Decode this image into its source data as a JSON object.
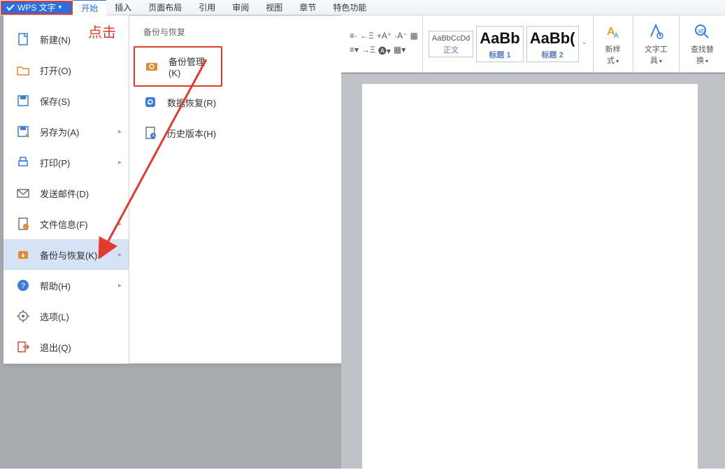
{
  "app": {
    "name": "WPS 文字"
  },
  "annotation": "点击",
  "tabs": [
    "开始",
    "插入",
    "页面布局",
    "引用",
    "审阅",
    "视图",
    "章节",
    "特色功能"
  ],
  "active_tab_index": 0,
  "menu": {
    "items": [
      {
        "label": "新建(N)",
        "icon": "file-new",
        "chev": false
      },
      {
        "label": "打开(O)",
        "icon": "folder-open",
        "chev": false
      },
      {
        "label": "保存(S)",
        "icon": "save",
        "chev": false
      },
      {
        "label": "另存为(A)",
        "icon": "save-as",
        "chev": true
      },
      {
        "label": "打印(P)",
        "icon": "print",
        "chev": true
      },
      {
        "label": "发送邮件(D)",
        "icon": "mail",
        "chev": false
      },
      {
        "label": "文件信息(F)",
        "icon": "file-info",
        "chev": true
      },
      {
        "label": "备份与恢复(K)",
        "icon": "backup",
        "chev": true,
        "hover": true
      },
      {
        "label": "帮助(H)",
        "icon": "help",
        "chev": true
      },
      {
        "label": "选项(L)",
        "icon": "options",
        "chev": false
      },
      {
        "label": "退出(Q)",
        "icon": "exit",
        "chev": false
      }
    ]
  },
  "submenu": {
    "title": "备份与恢复",
    "items": [
      {
        "label": "备份管理(K)",
        "icon": "backup-mgr",
        "boxed": true
      },
      {
        "label": "数据恢复(R)",
        "icon": "data-recover",
        "boxed": false
      },
      {
        "label": "历史版本(H)",
        "icon": "history",
        "boxed": false
      }
    ]
  },
  "ribbon": {
    "styles": [
      {
        "sample": "AaBbCcDd",
        "label": "正文",
        "big": false
      },
      {
        "sample": "AaBb",
        "label": "标题 1",
        "big": true
      },
      {
        "sample": "AaBb(",
        "label": "标题 2",
        "big": true
      }
    ],
    "newstyle": "新样式",
    "texttool": "文字工具",
    "findreplace": "查找替换"
  }
}
